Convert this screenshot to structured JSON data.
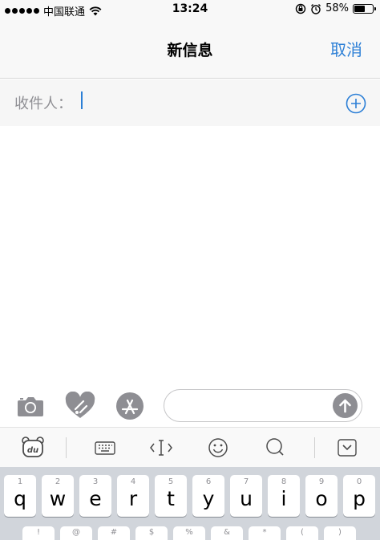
{
  "status_bar": {
    "carrier": "中国联通",
    "time": "13:24",
    "battery": "58%",
    "battery_level": 0.58
  },
  "nav": {
    "title": "新信息",
    "cancel": "取消"
  },
  "recipient": {
    "label": "收件人：",
    "value": ""
  },
  "compose": {
    "icons": [
      "camera-icon",
      "digital-touch-icon",
      "app-store-icon"
    ],
    "message_value": "",
    "send_icon": "send-arrow-icon"
  },
  "keyboard_toolbar": {
    "icons": [
      "du-bear-icon",
      "keyboard-icon",
      "cursor-move-icon",
      "emoji-icon",
      "search-icon",
      "collapse-keyboard-icon"
    ]
  },
  "keyboard": {
    "row1": [
      {
        "key": "q",
        "hint": "1"
      },
      {
        "key": "w",
        "hint": "2"
      },
      {
        "key": "e",
        "hint": "3"
      },
      {
        "key": "r",
        "hint": "4"
      },
      {
        "key": "t",
        "hint": "5"
      },
      {
        "key": "y",
        "hint": "6"
      },
      {
        "key": "u",
        "hint": "7"
      },
      {
        "key": "i",
        "hint": "8"
      },
      {
        "key": "o",
        "hint": "9"
      },
      {
        "key": "p",
        "hint": "0"
      }
    ],
    "row2_hints": [
      "!",
      "@",
      "#",
      "$",
      "%",
      "&",
      "*",
      "(",
      ")"
    ]
  },
  "colors": {
    "accent": "#2c7fd6",
    "bar_background": "#f8f8f8",
    "keyboard_background": "#d1d5db",
    "icon_gray": "#8e8e93"
  }
}
